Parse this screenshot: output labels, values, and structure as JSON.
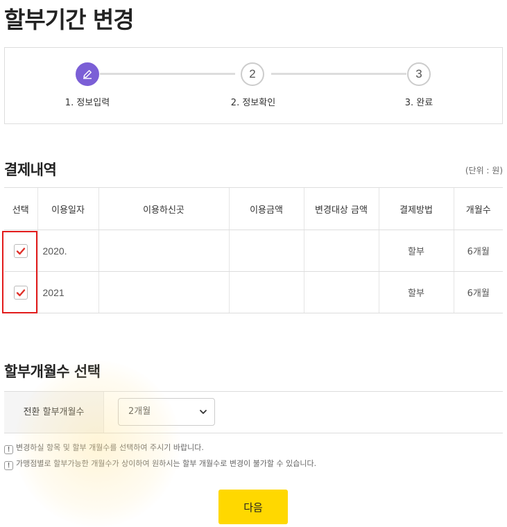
{
  "page": {
    "title": "할부기간 변경"
  },
  "stepper": {
    "steps": [
      {
        "number": "1",
        "label": "1. 정보입력",
        "state": "active",
        "icon": "pencil-icon"
      },
      {
        "number": "2",
        "label": "2. 정보확인",
        "state": "inactive"
      },
      {
        "number": "3",
        "label": "3. 완료",
        "state": "inactive"
      }
    ],
    "active_color": "#7b5fd6"
  },
  "payment": {
    "section_title": "결제내역",
    "unit_note": "(단위 : 원)",
    "headers": [
      "선택",
      "이용일자",
      "이용하신곳",
      "이용금액",
      "변경대상 금액",
      "결제방법",
      "개월수"
    ],
    "rows": [
      {
        "checked": true,
        "date": "2020.",
        "merchant": "",
        "amount": "",
        "target_amount": "",
        "method": "할부",
        "months": "6개월"
      },
      {
        "checked": true,
        "date": "2021",
        "merchant": "",
        "amount": "",
        "target_amount": "",
        "method": "할부",
        "months": "6개월"
      }
    ]
  },
  "installment": {
    "section_title": "할부개월수 선택",
    "label": "전환 할부개월수",
    "selected": "2개월"
  },
  "notices": [
    "변경하실 항목 및 할부 개월수를 선택하여 주시기 바랍니다.",
    "가맹점별로 할부가능한 개월수가 상이하여 원하시는 할부 개월수로 변경이 불가할 수 있습니다."
  ],
  "next_button": {
    "label": "다음",
    "color": "#ffd800"
  }
}
